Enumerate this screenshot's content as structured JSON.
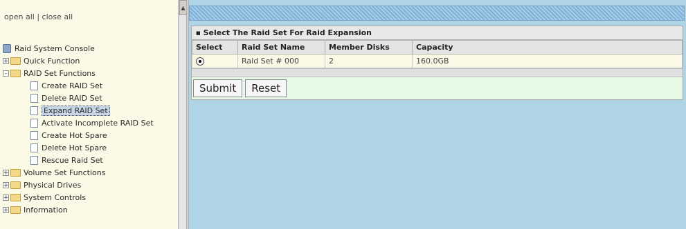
{
  "left": {
    "open_all": "open all",
    "divider": "|",
    "close_all": "close all",
    "root": "Raid System Console",
    "tree": [
      {
        "label": "Quick Function",
        "type": "folder",
        "expand": "+"
      },
      {
        "label": "RAID Set Functions",
        "type": "folder",
        "expand": "-"
      },
      {
        "label": "Create RAID Set",
        "type": "doc"
      },
      {
        "label": "Delete RAID Set",
        "type": "doc"
      },
      {
        "label": "Expand RAID Set",
        "type": "doc"
      },
      {
        "label": "Activate Incomplete RAID Set",
        "type": "doc"
      },
      {
        "label": "Create Hot Spare",
        "type": "doc"
      },
      {
        "label": "Delete Hot Spare",
        "type": "doc"
      },
      {
        "label": "Rescue Raid Set",
        "type": "doc"
      },
      {
        "label": "Volume Set Functions",
        "type": "folder",
        "expand": "+"
      },
      {
        "label": "Physical Drives",
        "type": "folder",
        "expand": "+"
      },
      {
        "label": "System Controls",
        "type": "folder",
        "expand": "+"
      },
      {
        "label": "Information",
        "type": "folder",
        "expand": "+"
      }
    ]
  },
  "main": {
    "panel_title": "Select The Raid Set For Raid Expansion",
    "columns": [
      "Select",
      "Raid Set Name",
      "Member Disks",
      "Capacity"
    ],
    "rows": [
      {
        "name": "Raid Set # 000",
        "members": "2",
        "capacity": "160.0GB"
      }
    ],
    "submit": "Submit",
    "reset": "Reset"
  }
}
